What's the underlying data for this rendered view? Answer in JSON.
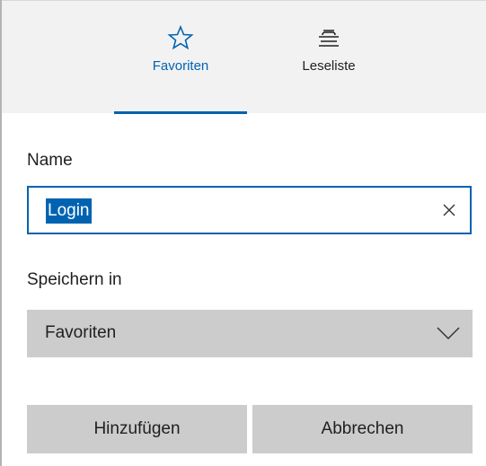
{
  "tabs": [
    {
      "label": "Favoriten",
      "icon": "star-outline-icon",
      "selected": true
    },
    {
      "label": "Leseliste",
      "icon": "reading-list-icon",
      "selected": false
    }
  ],
  "form": {
    "name_label": "Name",
    "name_value": "Login",
    "save_in_label": "Speichern in",
    "save_in_value": "Favoriten"
  },
  "buttons": {
    "add_label": "Hinzufügen",
    "cancel_label": "Abbrechen"
  },
  "colors": {
    "accent": "#0063b1",
    "header_bg": "#f2f2f2",
    "control_bg": "#cccccc"
  }
}
